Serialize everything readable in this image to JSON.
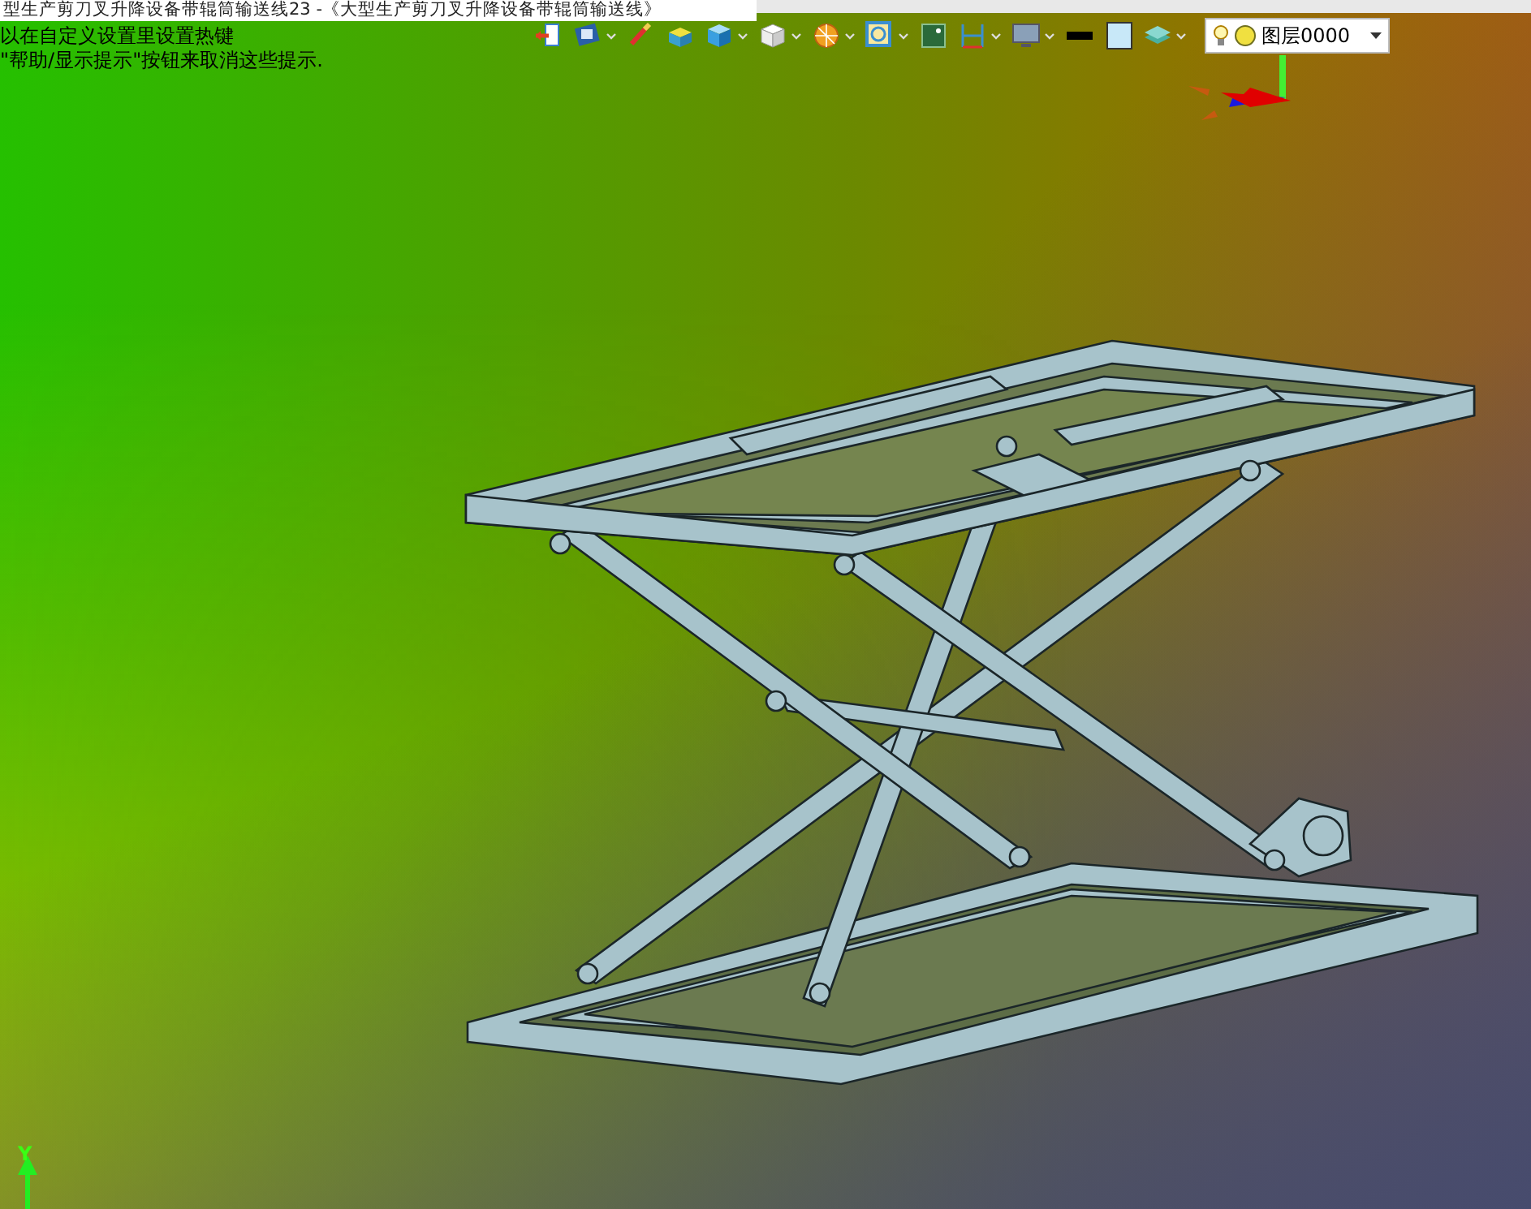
{
  "document_tab": {
    "title": "型生产剪刀叉升降设备带辊筒输送线23 -《大型生产剪刀叉升降设备带辊筒输送线》"
  },
  "hints": [
    "以在自定义设置里设置热键",
    "\"帮助/显示提示\"按钮来取消这些提示."
  ],
  "toolbar": [
    {
      "kind": "exit",
      "has_menu": false
    },
    {
      "kind": "view",
      "has_menu": true
    },
    {
      "kind": "brush",
      "has_menu": false
    },
    {
      "kind": "box",
      "has_menu": false
    },
    {
      "kind": "cube",
      "has_menu": true
    },
    {
      "kind": "white-cube",
      "has_menu": true
    },
    {
      "kind": "pie",
      "has_menu": true
    },
    {
      "kind": "zoom",
      "has_menu": true
    },
    {
      "kind": "frame",
      "has_menu": false
    },
    {
      "kind": "dimension",
      "has_menu": true
    },
    {
      "kind": "monitor",
      "has_menu": true
    },
    {
      "kind": "line",
      "has_menu": false
    },
    {
      "kind": "square",
      "has_menu": false
    },
    {
      "kind": "layers",
      "has_menu": true
    }
  ],
  "layer_selector": {
    "label": "图层0000"
  },
  "axis_indicator": {
    "label": "Y"
  }
}
